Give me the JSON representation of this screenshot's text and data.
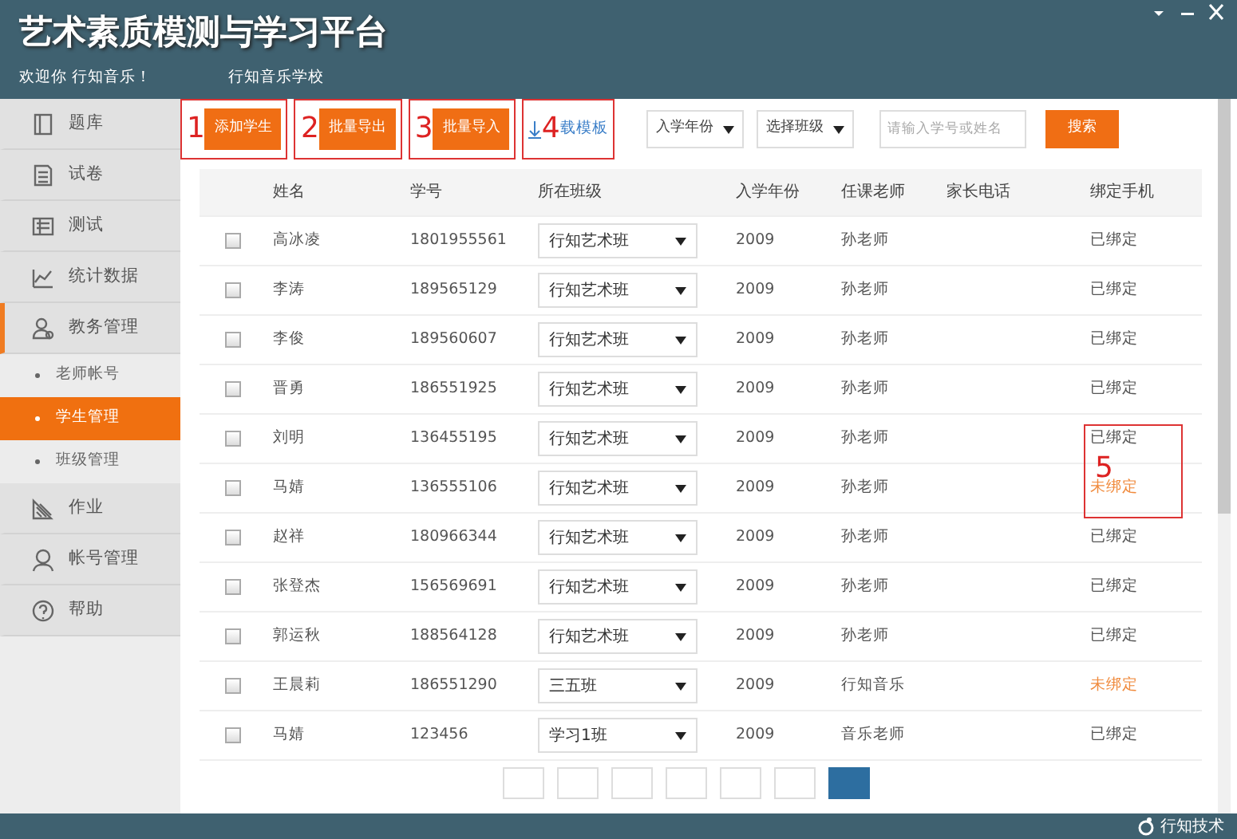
{
  "window": {
    "title": "艺术素质模测与学习平台",
    "welcome": "欢迎你 行知音乐！",
    "school": "行知音乐学校"
  },
  "sidebar": {
    "items": [
      {
        "label": "题库",
        "selected": false
      },
      {
        "label": "试卷",
        "selected": false
      },
      {
        "label": "测试",
        "selected": false
      },
      {
        "label": "统计数据",
        "selected": false
      },
      {
        "label": "教务管理",
        "selected": false,
        "expanded": true,
        "children": [
          {
            "label": "老师帐号",
            "selected": false
          },
          {
            "label": "学生管理",
            "selected": true
          },
          {
            "label": "班级管理",
            "selected": false
          }
        ]
      },
      {
        "label": "作业",
        "selected": false
      },
      {
        "label": "帐号管理",
        "selected": false
      },
      {
        "label": "帮助",
        "selected": false
      }
    ]
  },
  "toolbar": {
    "buttons": [
      {
        "kind": "button",
        "label": "添加学生",
        "annotation": "1"
      },
      {
        "kind": "button",
        "label": "批量导出",
        "annotation": "2"
      },
      {
        "kind": "button",
        "label": "批量导入",
        "annotation": "3"
      },
      {
        "kind": "link",
        "label": "载模板",
        "annotation": "4"
      }
    ],
    "filters": [
      {
        "label": "入学年份"
      },
      {
        "label": "选择班级"
      }
    ],
    "search": {
      "placeholder": "请输入学号或姓名",
      "button": "搜索"
    }
  },
  "table": {
    "columns": [
      "姓名",
      "学号",
      "所在班级",
      "入学年份",
      "任课老师",
      "家长电话",
      "绑定手机"
    ],
    "rows": [
      {
        "checked": false,
        "name": "高冰凌",
        "id": "1801955561",
        "class": "行知艺术班",
        "year": "2009",
        "teacher": "孙老师",
        "bound": true,
        "status": "已绑定"
      },
      {
        "checked": false,
        "name": "李涛",
        "id": "189565129",
        "class": "行知艺术班",
        "year": "2009",
        "teacher": "孙老师",
        "bound": true,
        "status": "已绑定"
      },
      {
        "checked": false,
        "name": "李俊",
        "id": "189560607",
        "class": "行知艺术班",
        "year": "2009",
        "teacher": "孙老师",
        "bound": true,
        "status": "已绑定"
      },
      {
        "checked": false,
        "name": "晋勇",
        "id": "186551925",
        "class": "行知艺术班",
        "year": "2009",
        "teacher": "孙老师",
        "bound": true,
        "status": "已绑定"
      },
      {
        "checked": false,
        "name": "刘明",
        "id": "136455195",
        "class": "行知艺术班",
        "year": "2009",
        "teacher": "孙老师",
        "bound": true,
        "status": "已绑定"
      },
      {
        "checked": false,
        "name": "马婧",
        "id": "136555106",
        "class": "行知艺术班",
        "year": "2009",
        "teacher": "孙老师",
        "bound": false,
        "status": "未绑定"
      },
      {
        "checked": false,
        "name": "赵祥",
        "id": "180966344",
        "class": "行知艺术班",
        "year": "2009",
        "teacher": "孙老师",
        "bound": true,
        "status": "已绑定"
      },
      {
        "checked": false,
        "name": "张登杰",
        "id": "156569691",
        "class": "行知艺术班",
        "year": "2009",
        "teacher": "孙老师",
        "bound": true,
        "status": "已绑定"
      },
      {
        "checked": false,
        "name": "郭运秋",
        "id": "188564128",
        "class": "行知艺术班",
        "year": "2009",
        "teacher": "孙老师",
        "bound": true,
        "status": "已绑定"
      },
      {
        "checked": false,
        "name": "王晨莉",
        "id": "186551290",
        "class": "三五班",
        "year": "2009",
        "teacher": "行知音乐",
        "bound": false,
        "status": "未绑定"
      },
      {
        "checked": false,
        "name": "马婧",
        "id": "123456",
        "class": "学习1班",
        "year": "2009",
        "teacher": "音乐老师",
        "bound": true,
        "status": "已绑定"
      }
    ],
    "annotation": "5"
  },
  "pagination": {
    "pages": [
      {
        "selected": false
      },
      {
        "selected": false
      },
      {
        "selected": false
      },
      {
        "selected": false
      },
      {
        "selected": false
      },
      {
        "selected": false
      },
      {
        "selected": true
      }
    ]
  },
  "footer": {
    "brand": "行知技术"
  }
}
